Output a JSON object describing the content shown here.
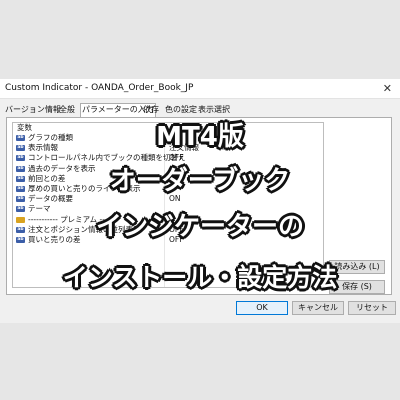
{
  "window": {
    "title": "Custom Indicator - OANDA_Order_Book_JP",
    "close_glyph": "✕"
  },
  "tabs": [
    {
      "label": "バージョン情報"
    },
    {
      "label": "全般"
    },
    {
      "label": "パラメーターの入力"
    },
    {
      "label": "依存"
    },
    {
      "label": "色の設定"
    },
    {
      "label": "表示選択"
    }
  ],
  "params": {
    "header": "変数",
    "rows": [
      {
        "type": "ab",
        "name": "グラフの種類",
        "value": "集"
      },
      {
        "type": "ab",
        "name": "表示情報",
        "value": "注文情報"
      },
      {
        "type": "ab",
        "name": "コントロールパネル内でブックの種類を切替え",
        "value": "OFF"
      },
      {
        "type": "ab",
        "name": "過去のデータを表示",
        "value": ""
      },
      {
        "type": "ab",
        "name": "前回との差",
        "value": "OFF"
      },
      {
        "type": "ab",
        "name": "厚めの買いと売りのラインを表示",
        "value": "1"
      },
      {
        "type": "ab",
        "name": "データの概要",
        "value": "ON"
      },
      {
        "type": "ab",
        "name": "テーマ",
        "value": ""
      },
      {
        "type": "gold",
        "name": "----------- プレミアム ---",
        "value": ""
      },
      {
        "type": "ab",
        "name": "注文とポジション情報の並列表示",
        "value": "OFF"
      },
      {
        "type": "ab",
        "name": "買いと売りの差",
        "value": "OFF"
      }
    ]
  },
  "side_buttons": {
    "load": "読み込み (L)",
    "save": "保存 (S)"
  },
  "footer_buttons": {
    "ok": "OK",
    "cancel": "キャンセル",
    "reset": "リセット"
  },
  "overlay": {
    "line1": "MT4版",
    "line2": "オーダーブック",
    "line3": "インジケーターの",
    "line4": "インストール・設定方法"
  },
  "colors": {
    "accent": "#0078d7",
    "param_icon": "#3b5ea8",
    "premium_icon": "#d9a320"
  }
}
